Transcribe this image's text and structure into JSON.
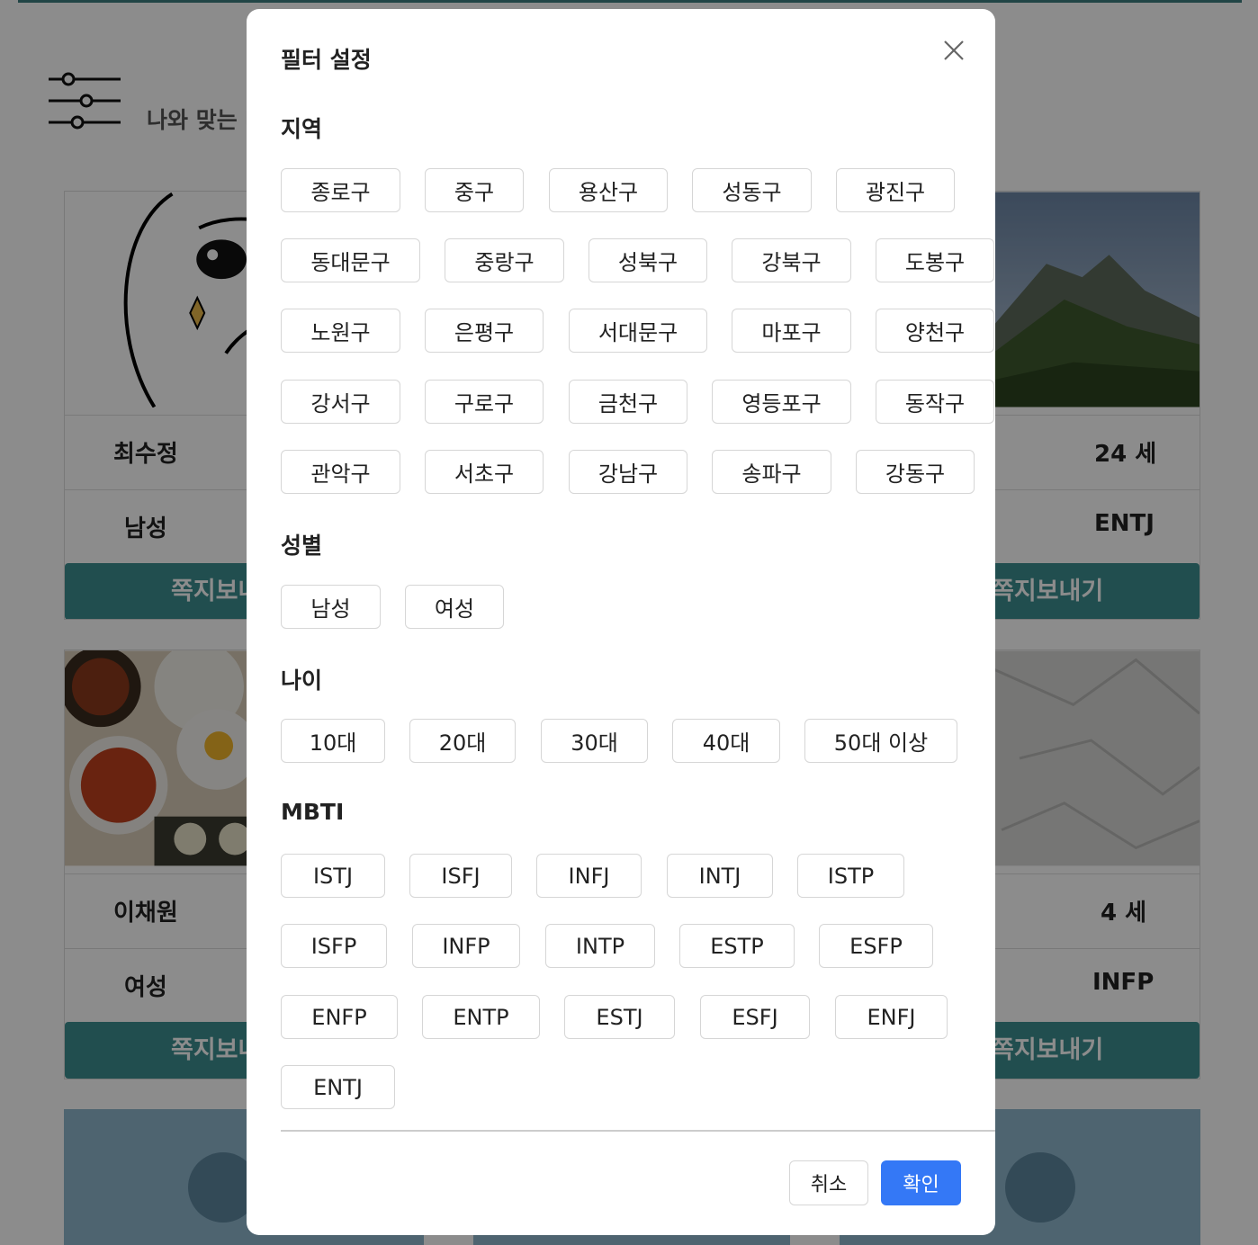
{
  "background": {
    "header_title": "나와 맞는 메이트 찾기",
    "cards": [
      {
        "name": "최수정",
        "age": "",
        "gender": "남성",
        "mbti": "",
        "button": "쪽지보내기"
      },
      {
        "name": "",
        "age": "24 세",
        "gender": "",
        "mbti": "ENTJ",
        "button": "쪽지보내기"
      },
      {
        "name": "이채원",
        "age": "",
        "gender": "여성",
        "mbti": "",
        "button": "쪽지보내기"
      },
      {
        "name": "",
        "age": "4 세",
        "gender": "",
        "mbti": "INFP",
        "button": "쪽지보내기"
      }
    ]
  },
  "modal": {
    "title": "필터 설정",
    "region": {
      "title": "지역",
      "options": [
        "종로구",
        "중구",
        "용산구",
        "성동구",
        "광진구",
        "동대문구",
        "중랑구",
        "성북구",
        "강북구",
        "도봉구",
        "노원구",
        "은평구",
        "서대문구",
        "마포구",
        "양천구",
        "강서구",
        "구로구",
        "금천구",
        "영등포구",
        "동작구",
        "관악구",
        "서초구",
        "강남구",
        "송파구",
        "강동구"
      ]
    },
    "gender": {
      "title": "성별",
      "options": [
        "남성",
        "여성"
      ]
    },
    "age": {
      "title": "나이",
      "options": [
        "10대",
        "20대",
        "30대",
        "40대",
        "50대 이상"
      ]
    },
    "mbti": {
      "title": "MBTI",
      "options": [
        "ISTJ",
        "ISFJ",
        "INFJ",
        "INTJ",
        "ISTP",
        "ISFP",
        "INFP",
        "INTP",
        "ESTP",
        "ESFP",
        "ENFP",
        "ENTP",
        "ESTJ",
        "ESFJ",
        "ENFJ",
        "ENTJ"
      ]
    },
    "cancel_label": "취소",
    "confirm_label": "확인",
    "confirm_color": "#3478f6"
  }
}
